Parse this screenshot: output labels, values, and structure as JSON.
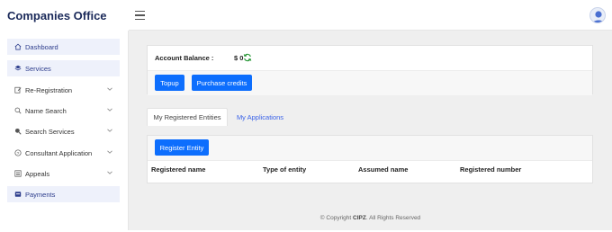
{
  "header": {
    "brand": "Companies Office",
    "menu_icon": "hamburger-icon",
    "avatar_icon": "user-avatar-icon"
  },
  "sidebar": {
    "items": [
      {
        "label": "Dashboard",
        "icon": "home-icon",
        "active": true,
        "has_chevron": false
      },
      {
        "label": "Services",
        "icon": "layers-icon",
        "active": true,
        "has_chevron": false
      },
      {
        "label": "Re-Registration",
        "icon": "edit-document-icon",
        "active": false,
        "has_chevron": true
      },
      {
        "label": "Name Search",
        "icon": "search-icon",
        "active": false,
        "has_chevron": true
      },
      {
        "label": "Search Services",
        "icon": "search-filled-icon",
        "active": false,
        "has_chevron": true
      },
      {
        "label": "Consultant Application",
        "icon": "question-circle-icon",
        "active": false,
        "has_chevron": true
      },
      {
        "label": "Appeals",
        "icon": "list-icon",
        "active": false,
        "has_chevron": true
      },
      {
        "label": "Payments",
        "icon": "payment-icon",
        "active": true,
        "has_chevron": false
      }
    ]
  },
  "account": {
    "balance_label": "Account Balance :",
    "balance_value": "$ 0",
    "refresh_icon": "refresh-icon",
    "topup_label": "Topup",
    "purchase_label": "Purchase credits"
  },
  "tabs": [
    {
      "label": "My Registered Entities",
      "active": true
    },
    {
      "label": "My Applications",
      "active": false
    }
  ],
  "entities": {
    "register_label": "Register Entity",
    "columns": [
      "Registered name",
      "Type of entity",
      "Assumed name",
      "Registered number"
    ]
  },
  "footer": {
    "prefix": "© Copyright",
    "company": "CIPZ",
    "suffix": ". All Rights Reserved"
  },
  "colors": {
    "primary": "#0d6efd",
    "brand_text": "#1b2a5a",
    "link": "#3b63e8",
    "refresh": "#2e9a3c",
    "active_nav": "#eef1fb"
  }
}
